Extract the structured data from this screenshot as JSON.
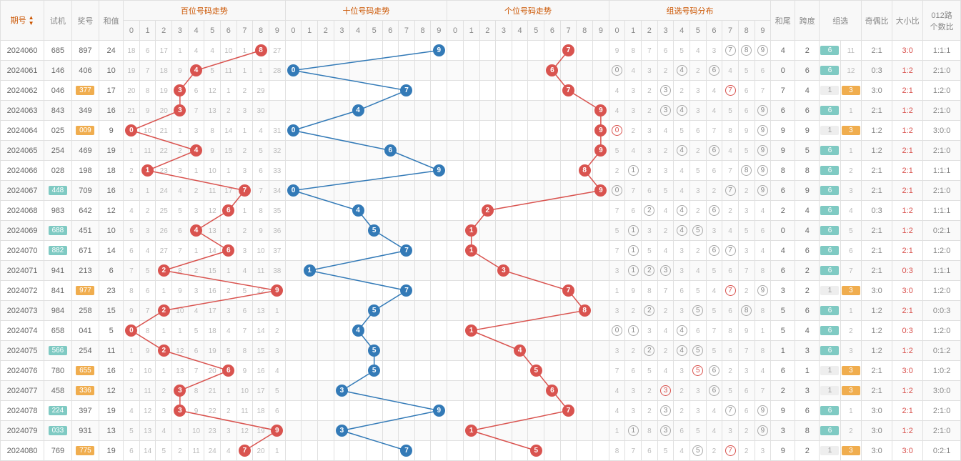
{
  "headers": {
    "period": "期号",
    "test": "试机",
    "prize": "奖号",
    "sum": "和值",
    "hundreds": "百位号码走势",
    "tens": "十位号码走势",
    "units": "个位号码走势",
    "combo": "组选号码分布",
    "tail": "和尾",
    "span": "跨度",
    "group": "组选",
    "odd_even": "奇偶比",
    "big_small": "大小比",
    "route012": "012路\n个数比"
  },
  "digits": [
    "0",
    "1",
    "2",
    "3",
    "4",
    "5",
    "6",
    "7",
    "8",
    "9"
  ],
  "chart_data": {
    "type": "table",
    "title": "3D Lottery Trend Chart",
    "columns": [
      "period",
      "test",
      "prize",
      "sum",
      "hundreds_digit",
      "tens_digit",
      "units_digit",
      "tail",
      "span",
      "group",
      "odd_even",
      "big_small",
      "route012"
    ],
    "rows": [
      {
        "period": "2024060",
        "test": "685",
        "prize": "897",
        "sum": 24,
        "h": 8,
        "t": 9,
        "u": 7,
        "combo": [
          7,
          8,
          9
        ],
        "combo_red": [],
        "tail": 4,
        "span": 2,
        "group": "6",
        "group_n": 11,
        "oe": "2:1",
        "bs": "3:0",
        "r012": "1:1:1",
        "test_hl": false,
        "prize_hl": false,
        "bs_red": true,
        "oe_red": false
      },
      {
        "period": "2024061",
        "test": "146",
        "prize": "406",
        "sum": 10,
        "h": 4,
        "t": 0,
        "u": 6,
        "combo": [
          0,
          4,
          6
        ],
        "combo_red": [],
        "tail": 0,
        "span": 6,
        "group": "6",
        "group_n": 12,
        "oe": "0:3",
        "bs": "1:2",
        "r012": "2:1:0",
        "test_hl": false,
        "prize_hl": false,
        "bs_red": true,
        "oe_red": false
      },
      {
        "period": "2024062",
        "test": "046",
        "prize": "377",
        "sum": 17,
        "h": 3,
        "t": 7,
        "u": 7,
        "combo": [
          3,
          7
        ],
        "combo_red": [
          7
        ],
        "tail": 7,
        "span": 4,
        "group": "1",
        "group_n": 3,
        "oe": "3:0",
        "bs": "2:1",
        "r012": "1:2:0",
        "test_hl": false,
        "prize_hl": true,
        "bs_red": true,
        "oe_red": false,
        "group_orange": true
      },
      {
        "period": "2024063",
        "test": "843",
        "prize": "349",
        "sum": 16,
        "h": 3,
        "t": 4,
        "u": 9,
        "combo": [
          3,
          4,
          9
        ],
        "combo_red": [],
        "tail": 6,
        "span": 6,
        "group": "6",
        "group_n": 1,
        "oe": "2:1",
        "bs": "1:2",
        "r012": "2:1:0",
        "test_hl": false,
        "prize_hl": false,
        "bs_red": true,
        "oe_red": false
      },
      {
        "period": "2024064",
        "test": "025",
        "prize": "009",
        "sum": 9,
        "h": 0,
        "t": 0,
        "u": 9,
        "combo": [
          0,
          9
        ],
        "combo_red": [
          0
        ],
        "tail": 9,
        "span": 9,
        "group": "1",
        "group_n": 3,
        "oe": "1:2",
        "bs": "1:2",
        "r012": "3:0:0",
        "test_hl": false,
        "prize_hl": true,
        "bs_red": true,
        "oe_red": false,
        "group_orange": true
      },
      {
        "period": "2024065",
        "test": "254",
        "prize": "469",
        "sum": 19,
        "h": 4,
        "t": 6,
        "u": 9,
        "combo": [
          4,
          6,
          9
        ],
        "combo_red": [],
        "tail": 9,
        "span": 5,
        "group": "6",
        "group_n": 1,
        "oe": "1:2",
        "bs": "2:1",
        "r012": "2:1:0",
        "test_hl": false,
        "prize_hl": false,
        "bs_red": true,
        "oe_red": false
      },
      {
        "period": "2024066",
        "test": "028",
        "prize": "198",
        "sum": 18,
        "h": 1,
        "t": 9,
        "u": 8,
        "combo": [
          1,
          8,
          9
        ],
        "combo_red": [],
        "tail": 8,
        "span": 8,
        "group": "6",
        "group_n": 2,
        "oe": "2:1",
        "bs": "2:1",
        "r012": "1:1:1",
        "test_hl": false,
        "prize_hl": false,
        "bs_red": true,
        "oe_red": false
      },
      {
        "period": "2024067",
        "test": "448",
        "prize": "709",
        "sum": 16,
        "h": 7,
        "t": 0,
        "u": 9,
        "combo": [
          0,
          7,
          9
        ],
        "combo_red": [],
        "tail": 6,
        "span": 9,
        "group": "6",
        "group_n": 3,
        "oe": "2:1",
        "bs": "2:1",
        "r012": "2:1:0",
        "test_hl": true,
        "prize_hl": false,
        "bs_red": true,
        "oe_red": false
      },
      {
        "period": "2024068",
        "test": "983",
        "prize": "642",
        "sum": 12,
        "h": 6,
        "t": 4,
        "u": 2,
        "combo": [
          2,
          4,
          6
        ],
        "combo_red": [],
        "tail": 2,
        "span": 4,
        "group": "6",
        "group_n": 4,
        "oe": "0:3",
        "bs": "1:2",
        "r012": "1:1:1",
        "test_hl": false,
        "prize_hl": false,
        "bs_red": true,
        "oe_red": false
      },
      {
        "period": "2024069",
        "test": "688",
        "prize": "451",
        "sum": 10,
        "h": 4,
        "t": 5,
        "u": 1,
        "combo": [
          1,
          4,
          5
        ],
        "combo_red": [],
        "tail": 0,
        "span": 4,
        "group": "6",
        "group_n": 5,
        "oe": "2:1",
        "bs": "1:2",
        "r012": "0:2:1",
        "test_hl": true,
        "prize_hl": false,
        "bs_red": true,
        "oe_red": false
      },
      {
        "period": "2024070",
        "test": "882",
        "prize": "671",
        "sum": 14,
        "h": 6,
        "t": 7,
        "u": 1,
        "combo": [
          1,
          6,
          7
        ],
        "combo_red": [],
        "tail": 4,
        "span": 6,
        "group": "6",
        "group_n": 6,
        "oe": "2:1",
        "bs": "2:1",
        "r012": "1:2:0",
        "test_hl": true,
        "prize_hl": false,
        "bs_red": true,
        "oe_red": false
      },
      {
        "period": "2024071",
        "test": "941",
        "prize": "213",
        "sum": 6,
        "h": 2,
        "t": 1,
        "u": 3,
        "combo": [
          1,
          2,
          3
        ],
        "combo_red": [],
        "tail": 6,
        "span": 2,
        "group": "6",
        "group_n": 7,
        "oe": "2:1",
        "bs": "0:3",
        "r012": "1:1:1",
        "test_hl": false,
        "prize_hl": false,
        "bs_red": true,
        "oe_red": false
      },
      {
        "period": "2024072",
        "test": "841",
        "prize": "977",
        "sum": 23,
        "h": 9,
        "t": 7,
        "u": 7,
        "combo": [
          7,
          9
        ],
        "combo_red": [
          7
        ],
        "tail": 3,
        "span": 2,
        "group": "1",
        "group_n": 3,
        "oe": "3:0",
        "bs": "3:0",
        "r012": "1:2:0",
        "test_hl": false,
        "prize_hl": true,
        "bs_red": true,
        "oe_red": false,
        "group_orange": true
      },
      {
        "period": "2024073",
        "test": "984",
        "prize": "258",
        "sum": 15,
        "h": 2,
        "t": 5,
        "u": 8,
        "combo": [
          2,
          5,
          8
        ],
        "combo_red": [],
        "tail": 5,
        "span": 6,
        "group": "6",
        "group_n": 1,
        "oe": "1:2",
        "bs": "2:1",
        "r012": "0:0:3",
        "test_hl": false,
        "prize_hl": false,
        "bs_red": true,
        "oe_red": false
      },
      {
        "period": "2024074",
        "test": "658",
        "prize": "041",
        "sum": 5,
        "h": 0,
        "t": 4,
        "u": 1,
        "combo": [
          0,
          1,
          4
        ],
        "combo_red": [],
        "tail": 5,
        "span": 4,
        "group": "6",
        "group_n": 2,
        "oe": "1:2",
        "bs": "0:3",
        "r012": "1:2:0",
        "test_hl": false,
        "prize_hl": false,
        "bs_red": true,
        "oe_red": false
      },
      {
        "period": "2024075",
        "test": "566",
        "prize": "254",
        "sum": 11,
        "h": 2,
        "t": 5,
        "u": 4,
        "combo": [
          2,
          4,
          5
        ],
        "combo_red": [],
        "tail": 1,
        "span": 3,
        "group": "6",
        "group_n": 3,
        "oe": "1:2",
        "bs": "1:2",
        "r012": "0:1:2",
        "test_hl": true,
        "prize_hl": false,
        "bs_red": true,
        "oe_red": false
      },
      {
        "period": "2024076",
        "test": "780",
        "prize": "655",
        "sum": 16,
        "h": 6,
        "t": 5,
        "u": 5,
        "combo": [
          5,
          6
        ],
        "combo_red": [
          5
        ],
        "tail": 6,
        "span": 1,
        "group": "1",
        "group_n": 3,
        "oe": "2:1",
        "bs": "3:0",
        "r012": "1:0:2",
        "test_hl": false,
        "prize_hl": true,
        "bs_red": true,
        "oe_red": false,
        "group_orange": true
      },
      {
        "period": "2024077",
        "test": "458",
        "prize": "336",
        "sum": 12,
        "h": 3,
        "t": 3,
        "u": 6,
        "combo": [
          3,
          6
        ],
        "combo_red": [
          3
        ],
        "tail": 2,
        "span": 3,
        "group": "1",
        "group_n": 3,
        "oe": "2:1",
        "bs": "1:2",
        "r012": "3:0:0",
        "test_hl": false,
        "prize_hl": true,
        "bs_red": true,
        "oe_red": false,
        "group_orange": true
      },
      {
        "period": "2024078",
        "test": "224",
        "prize": "397",
        "sum": 19,
        "h": 3,
        "t": 9,
        "u": 7,
        "combo": [
          3,
          7,
          9
        ],
        "combo_red": [],
        "tail": 9,
        "span": 6,
        "group": "6",
        "group_n": 1,
        "oe": "3:0",
        "bs": "2:1",
        "r012": "2:1:0",
        "test_hl": true,
        "prize_hl": false,
        "bs_red": true,
        "oe_red": false
      },
      {
        "period": "2024079",
        "test": "033",
        "prize": "931",
        "sum": 13,
        "h": 9,
        "t": 3,
        "u": 1,
        "combo": [
          1,
          3,
          9
        ],
        "combo_red": [],
        "tail": 3,
        "span": 8,
        "group": "6",
        "group_n": 2,
        "oe": "3:0",
        "bs": "1:2",
        "r012": "2:1:0",
        "test_hl": true,
        "prize_hl": false,
        "bs_red": true,
        "oe_red": false
      },
      {
        "period": "2024080",
        "test": "769",
        "prize": "775",
        "sum": 19,
        "h": 7,
        "t": 7,
        "u": 5,
        "combo": [
          5,
          7
        ],
        "combo_red": [
          7
        ],
        "tail": 9,
        "span": 2,
        "group": "1",
        "group_n": 3,
        "oe": "3:0",
        "bs": "3:0",
        "r012": "0:2:1",
        "test_hl": false,
        "prize_hl": true,
        "bs_red": true,
        "oe_red": false,
        "group_orange": true
      }
    ],
    "hundreds_bg": [
      [
        18,
        6,
        17,
        1,
        4,
        4,
        10,
        1,
        null,
        27
      ],
      [
        19,
        7,
        18,
        9,
        null,
        5,
        11,
        1,
        1,
        28
      ],
      [
        20,
        8,
        19,
        null,
        6,
        12,
        1,
        2,
        29
      ],
      [
        21,
        9,
        20,
        null,
        7,
        13,
        2,
        3,
        30
      ],
      [
        null,
        10,
        21,
        1,
        3,
        8,
        14,
        1,
        4,
        31
      ],
      [
        1,
        11,
        22,
        2,
        null,
        9,
        15,
        2,
        5,
        32
      ],
      [
        2,
        null,
        23,
        3,
        1,
        10,
        1,
        3,
        6,
        33
      ],
      [
        3,
        1,
        24,
        4,
        2,
        11,
        17,
        null,
        7,
        34
      ],
      [
        4,
        2,
        25,
        5,
        3,
        12,
        null,
        1,
        8,
        35
      ],
      [
        5,
        3,
        26,
        6,
        null,
        13,
        1,
        2,
        9,
        36
      ],
      [
        6,
        4,
        27,
        7,
        1,
        14,
        null,
        3,
        10,
        37
      ],
      [
        7,
        5,
        null,
        8,
        2,
        15,
        1,
        4,
        11,
        38
      ],
      [
        8,
        6,
        1,
        9,
        3,
        16,
        2,
        5,
        12,
        null
      ],
      [
        9,
        7,
        null,
        10,
        4,
        17,
        3,
        6,
        13,
        1
      ],
      [
        null,
        8,
        1,
        1,
        5,
        18,
        4,
        7,
        14,
        2
      ],
      [
        1,
        9,
        null,
        12,
        6,
        19,
        5,
        8,
        15,
        3
      ],
      [
        2,
        10,
        1,
        13,
        7,
        20,
        null,
        9,
        16,
        4
      ],
      [
        3,
        11,
        2,
        null,
        8,
        21,
        1,
        10,
        17,
        5
      ],
      [
        4,
        12,
        3,
        null,
        9,
        22,
        2,
        11,
        18,
        6
      ],
      [
        5,
        13,
        4,
        1,
        10,
        23,
        3,
        12,
        19,
        null
      ],
      [
        6,
        14,
        5,
        2,
        11,
        24,
        4,
        null,
        20,
        1
      ]
    ]
  }
}
